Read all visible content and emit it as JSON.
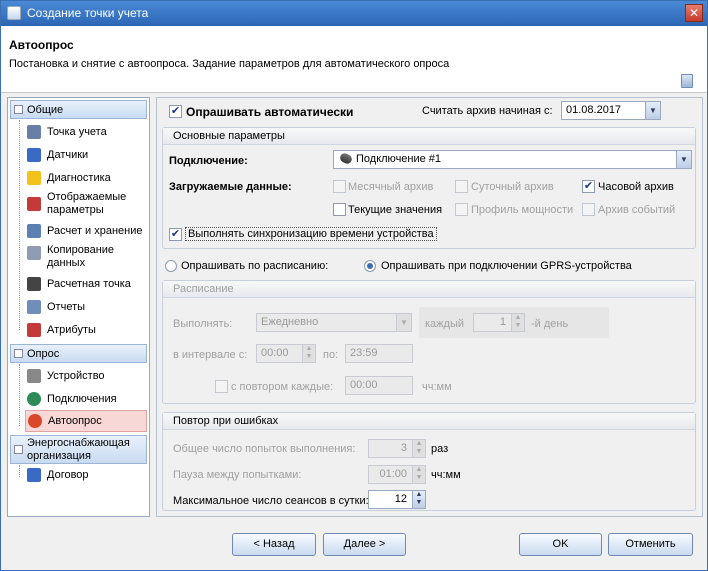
{
  "window": {
    "title": "Создание точки учета",
    "close_glyph": "✕"
  },
  "header": {
    "title": "Автоопрос",
    "subtitle": "Постановка и снятие с автоопроса. Задание параметров для автоматического опроса"
  },
  "sidebar": {
    "groups": [
      {
        "label": "Общие",
        "toggle": "-"
      },
      {
        "label": "Опрос",
        "toggle": "-"
      },
      {
        "label": "Энергоснабжающая организация",
        "toggle": "-"
      }
    ],
    "general_items": [
      {
        "label": "Точка учета",
        "icon": "meter-icon",
        "color": "#6a7fa5"
      },
      {
        "label": "Датчики",
        "icon": "pencil-icon",
        "color": "#3a6bc4"
      },
      {
        "label": "Диагностика",
        "icon": "warning-icon",
        "color": "#f3c21c"
      },
      {
        "label": "Отображаемые параметры",
        "icon": "checklist-icon",
        "color": "#c43a3a"
      },
      {
        "label": "Расчет и хранение",
        "icon": "calculator-icon",
        "color": "#5c7fb4"
      },
      {
        "label": "Копирование данных",
        "icon": "copy-icon",
        "color": "#8e9db3"
      },
      {
        "label": "Расчетная точка",
        "icon": "formula-icon",
        "color": "#444444"
      },
      {
        "label": "Отчеты",
        "icon": "report-icon",
        "color": "#6f8fb8"
      },
      {
        "label": "Атрибуты",
        "icon": "attribute-icon",
        "color": "#c43a3a"
      }
    ],
    "poll_items": [
      {
        "label": "Устройство",
        "icon": "gauge-icon",
        "color": "#888888"
      },
      {
        "label": "Подключения",
        "icon": "globe-icon",
        "color": "#2e8b57"
      },
      {
        "label": "Автоопрос",
        "icon": "clock-icon",
        "color": "#d9482b"
      }
    ],
    "org_items": [
      {
        "label": "Договор",
        "icon": "contract-icon",
        "color": "#3a6bc4"
      }
    ]
  },
  "autopoll": {
    "enabled_label": "Опрашивать автоматически",
    "archive_start_label": "Считать архив начиная с:",
    "archive_start_value": "01.08.2017"
  },
  "basic": {
    "title": "Основные параметры",
    "connection_label": "Подключение:",
    "connection_value": "Подключение #1",
    "loaded_label": "Загружаемые данные:",
    "options": [
      {
        "label": "Месячный архив",
        "checked": false,
        "disabled": true
      },
      {
        "label": "Суточный архив",
        "checked": false,
        "disabled": true
      },
      {
        "label": "Часовой архив",
        "checked": true,
        "disabled": false
      },
      {
        "label": "Текущие значения",
        "checked": false,
        "disabled": false
      },
      {
        "label": "Профиль мощности",
        "checked": false,
        "disabled": true
      },
      {
        "label": "Архив событий",
        "checked": false,
        "disabled": true
      }
    ],
    "sync_label": "Выполнять синхронизацию времени устройства"
  },
  "mode": {
    "schedule_label": "Опрашивать по расписанию:",
    "gprs_label": "Опрашивать при подключении GPRS-устройства"
  },
  "schedule": {
    "title": "Расписание",
    "run_label": "Выполнять:",
    "run_value": "Ежедневно",
    "every_label": "каждый",
    "every_value": "1",
    "day_suffix": "-й день",
    "interval_label": "в интервале с:",
    "from_value": "00:00",
    "to_label": "по:",
    "to_value": "23:59",
    "repeat_label": "с повтором каждые:",
    "repeat_value": "00:00",
    "repeat_unit": "чч:мм"
  },
  "retry": {
    "title": "Повтор при ошибках",
    "total_label": "Общее число попыток выполнения:",
    "total_value": "3",
    "total_unit": "раз",
    "pause_label": "Пауза между попытками:",
    "pause_value": "01:00",
    "pause_unit": "чч:мм",
    "max_label": "Максимальное число сеансов в сутки:",
    "max_value": "12"
  },
  "buttons": {
    "back": "< Назад",
    "next": "Далее >",
    "ok": "OK",
    "cancel": "Отменить"
  },
  "glyphs": {
    "check": "✔",
    "dropdown": "▼",
    "up": "▲",
    "down": "▼"
  }
}
